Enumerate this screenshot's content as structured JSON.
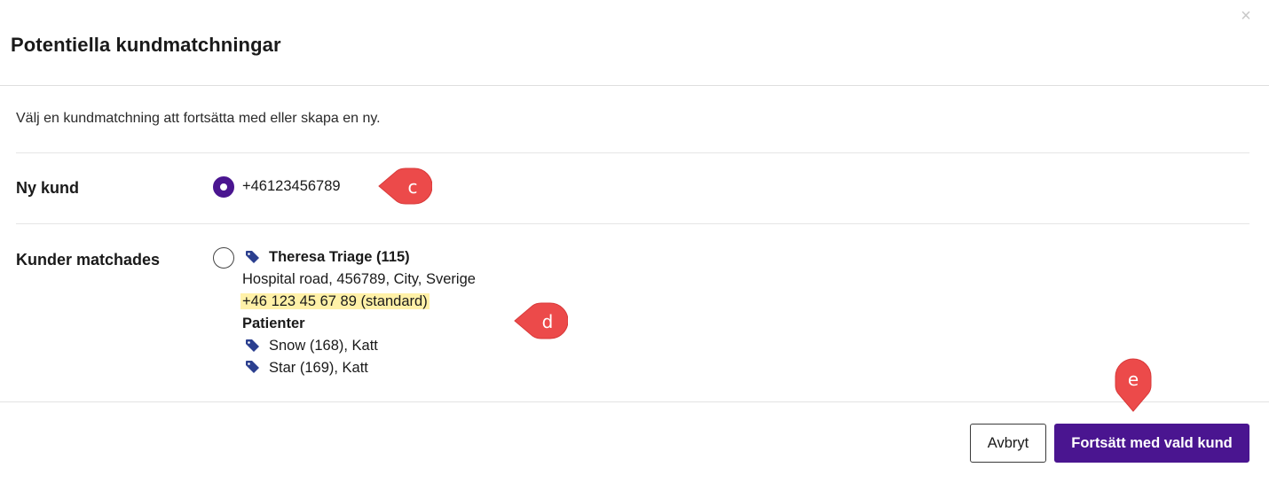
{
  "dialog": {
    "title": "Potentiella kundmatchningar",
    "close_glyph": "×",
    "intro": "Välj en kundmatchning att fortsätta med eller skapa en ny."
  },
  "new_customer": {
    "label": "Ny kund",
    "phone": "+46123456789",
    "selected": true
  },
  "matched_customers": {
    "label": "Kunder matchades",
    "customer": {
      "name": "Theresa Triage (115)",
      "address": "Hospital road, 456789, City, Sverige",
      "phone": "+46 123 45 67 89 (standard)"
    },
    "patients_heading": "Patienter",
    "patients": [
      {
        "name": "Snow (168), Katt",
        "icon": "tag-icon"
      },
      {
        "name": "Star (169), Katt",
        "icon": "tag-icon"
      }
    ],
    "selected": false
  },
  "callouts": {
    "c": "c",
    "d": "d",
    "e": "e"
  },
  "footer": {
    "cancel_label": "Avbryt",
    "continue_label": "Fortsätt med vald kund"
  },
  "colors": {
    "primary": "#4a1590",
    "callout": "#ec4a4a",
    "highlight": "#fff1a8",
    "tag": "#2b3f8f"
  }
}
